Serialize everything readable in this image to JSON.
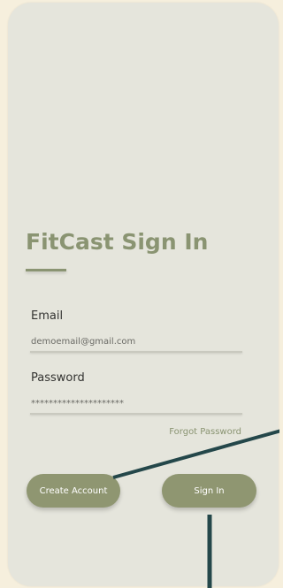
{
  "screen": {
    "title": "FitCast Sign In"
  },
  "form": {
    "email_label": "Email",
    "email_value": "demoemail@gmail.com",
    "password_label": "Password",
    "password_value": "*********************",
    "forgot_label": "Forgot Password"
  },
  "actions": {
    "create_account_label": "Create Account",
    "sign_in_label": "Sign In"
  },
  "colors": {
    "background": "#f6efdd",
    "card": "#e5e5dc",
    "accent": "#8a9472",
    "button": "#8f9671",
    "connector": "#24474a"
  }
}
